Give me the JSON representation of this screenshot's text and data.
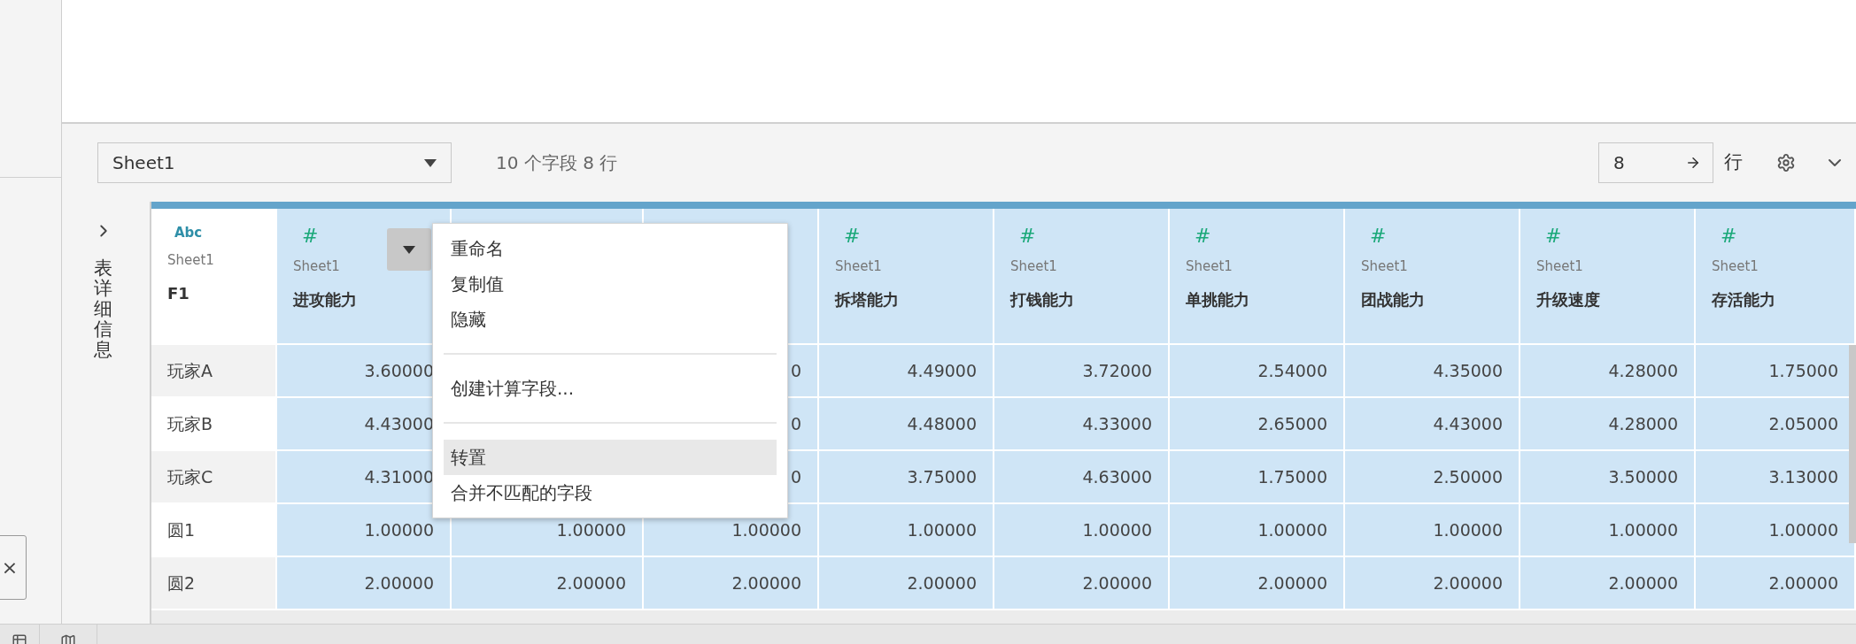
{
  "toolbar": {
    "sheet_select": "Sheet1",
    "summary": "10 个字段 8 行",
    "row_count": "8",
    "row_unit": "行"
  },
  "side_panel": {
    "label": "表详细信息"
  },
  "table": {
    "columns": [
      {
        "kind": "text",
        "type_label": "Abc",
        "source": "Sheet1",
        "name": "F1",
        "menu_open": false
      },
      {
        "kind": "number",
        "type_label": "#",
        "source": "Sheet1",
        "name": "进攻能力",
        "menu_open": true
      },
      {
        "kind": "covered"
      },
      {
        "kind": "covered"
      },
      {
        "kind": "number",
        "type_label": "#",
        "source": "Sheet1",
        "name": "拆塔能力",
        "menu_open": false
      },
      {
        "kind": "number",
        "type_label": "#",
        "source": "Sheet1",
        "name": "打钱能力",
        "menu_open": false
      },
      {
        "kind": "number",
        "type_label": "#",
        "source": "Sheet1",
        "name": "单挑能力",
        "menu_open": false
      },
      {
        "kind": "number",
        "type_label": "#",
        "source": "Sheet1",
        "name": "团战能力",
        "menu_open": false
      },
      {
        "kind": "number",
        "type_label": "#",
        "source": "Sheet1",
        "name": "升级速度",
        "menu_open": false
      },
      {
        "kind": "number",
        "type_label": "#",
        "source": "Sheet1",
        "name": "存活能力",
        "menu_open": false
      }
    ],
    "rows": [
      {
        "cells": [
          "玩家A",
          "3.60000",
          null,
          "0",
          "4.49000",
          "3.72000",
          "2.54000",
          "4.35000",
          "4.28000",
          "1.75000"
        ]
      },
      {
        "cells": [
          "玩家B",
          "4.43000",
          null,
          "0",
          "4.48000",
          "4.33000",
          "2.65000",
          "4.43000",
          "4.28000",
          "2.05000"
        ]
      },
      {
        "cells": [
          "玩家C",
          "4.31000",
          null,
          "0",
          "3.75000",
          "4.63000",
          "1.75000",
          "2.50000",
          "3.50000",
          "3.13000"
        ]
      },
      {
        "cells": [
          "圆1",
          "1.00000",
          "1.00000",
          "1.00000",
          "1.00000",
          "1.00000",
          "1.00000",
          "1.00000",
          "1.00000",
          "1.00000"
        ]
      },
      {
        "cells": [
          "圆2",
          "2.00000",
          "2.00000",
          "2.00000",
          "2.00000",
          "2.00000",
          "2.00000",
          "2.00000",
          "2.00000",
          "2.00000"
        ]
      }
    ]
  },
  "context_menu": {
    "items": [
      {
        "kind": "item",
        "label": "重命名",
        "selected": false
      },
      {
        "kind": "item",
        "label": "复制值",
        "selected": false
      },
      {
        "kind": "item",
        "label": "隐藏",
        "selected": false
      },
      {
        "kind": "separator"
      },
      {
        "kind": "item",
        "label": "创建计算字段...",
        "selected": false
      },
      {
        "kind": "separator"
      },
      {
        "kind": "item",
        "label": "转置",
        "selected": true
      },
      {
        "kind": "item",
        "label": "合并不匹配的字段",
        "selected": false
      }
    ]
  },
  "left_panel": {
    "close_label": "×"
  }
}
